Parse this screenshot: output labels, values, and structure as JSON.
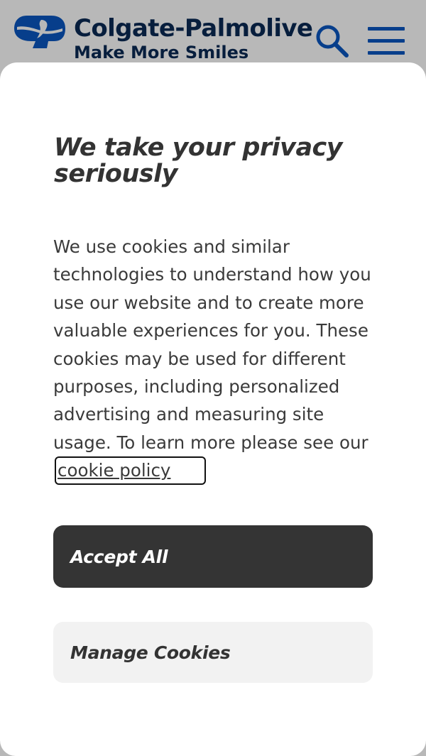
{
  "header": {
    "brand_name": "Colgate-Palmolive",
    "tagline": "Make More Smiles",
    "logo_icon": "colgate-logo-icon",
    "search_icon": "search-icon",
    "menu_icon": "hamburger-menu-icon",
    "brand_color": "#0B2A55",
    "accent_color": "#0A57C1"
  },
  "modal": {
    "title": "We take your privacy seriously",
    "body_text": "We use cookies and similar technologies to understand how you use our website and to create more valuable experiences for you. These cookies may be used for different purposes, including personalized advertising and measuring site usage. To learn more please see our",
    "link_text": "cookie policy",
    "accept_label": "Accept All",
    "manage_label": "Manage Cookies",
    "accept_bg": "#343434",
    "manage_bg": "#F2F2F2"
  }
}
